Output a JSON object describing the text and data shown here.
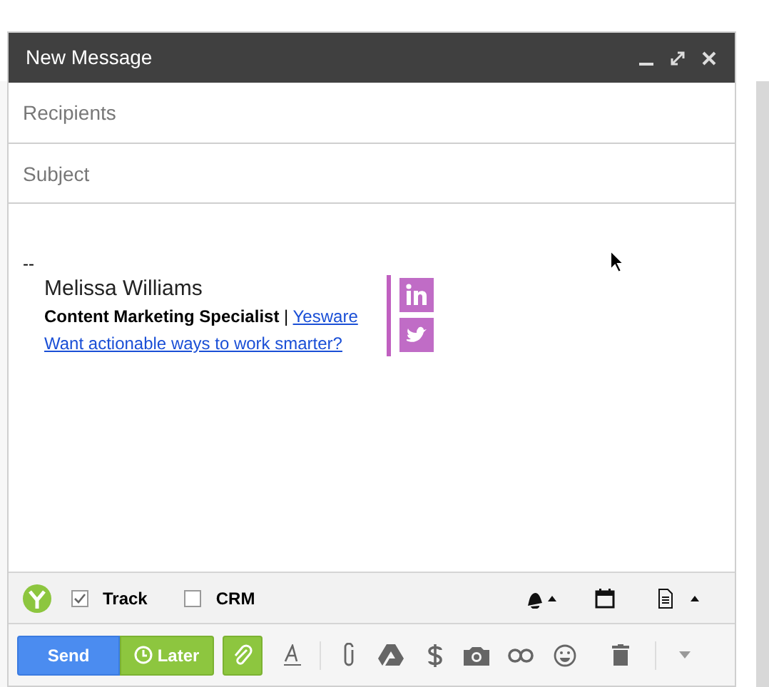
{
  "window": {
    "title": "New Message"
  },
  "recipients": {
    "placeholder": "Recipients"
  },
  "subject": {
    "placeholder": "Subject"
  },
  "signature": {
    "separator": "--",
    "name": "Melissa Williams",
    "role": "Content Marketing Specialist",
    "divider": "|",
    "company": "Yesware",
    "link": "Want actionable ways to work smarter?"
  },
  "yesware_bar": {
    "options": [
      {
        "label": "Track",
        "checked": true
      },
      {
        "label": "CRM",
        "checked": false
      }
    ]
  },
  "toolbar": {
    "send": "Send",
    "later": "Later"
  }
}
